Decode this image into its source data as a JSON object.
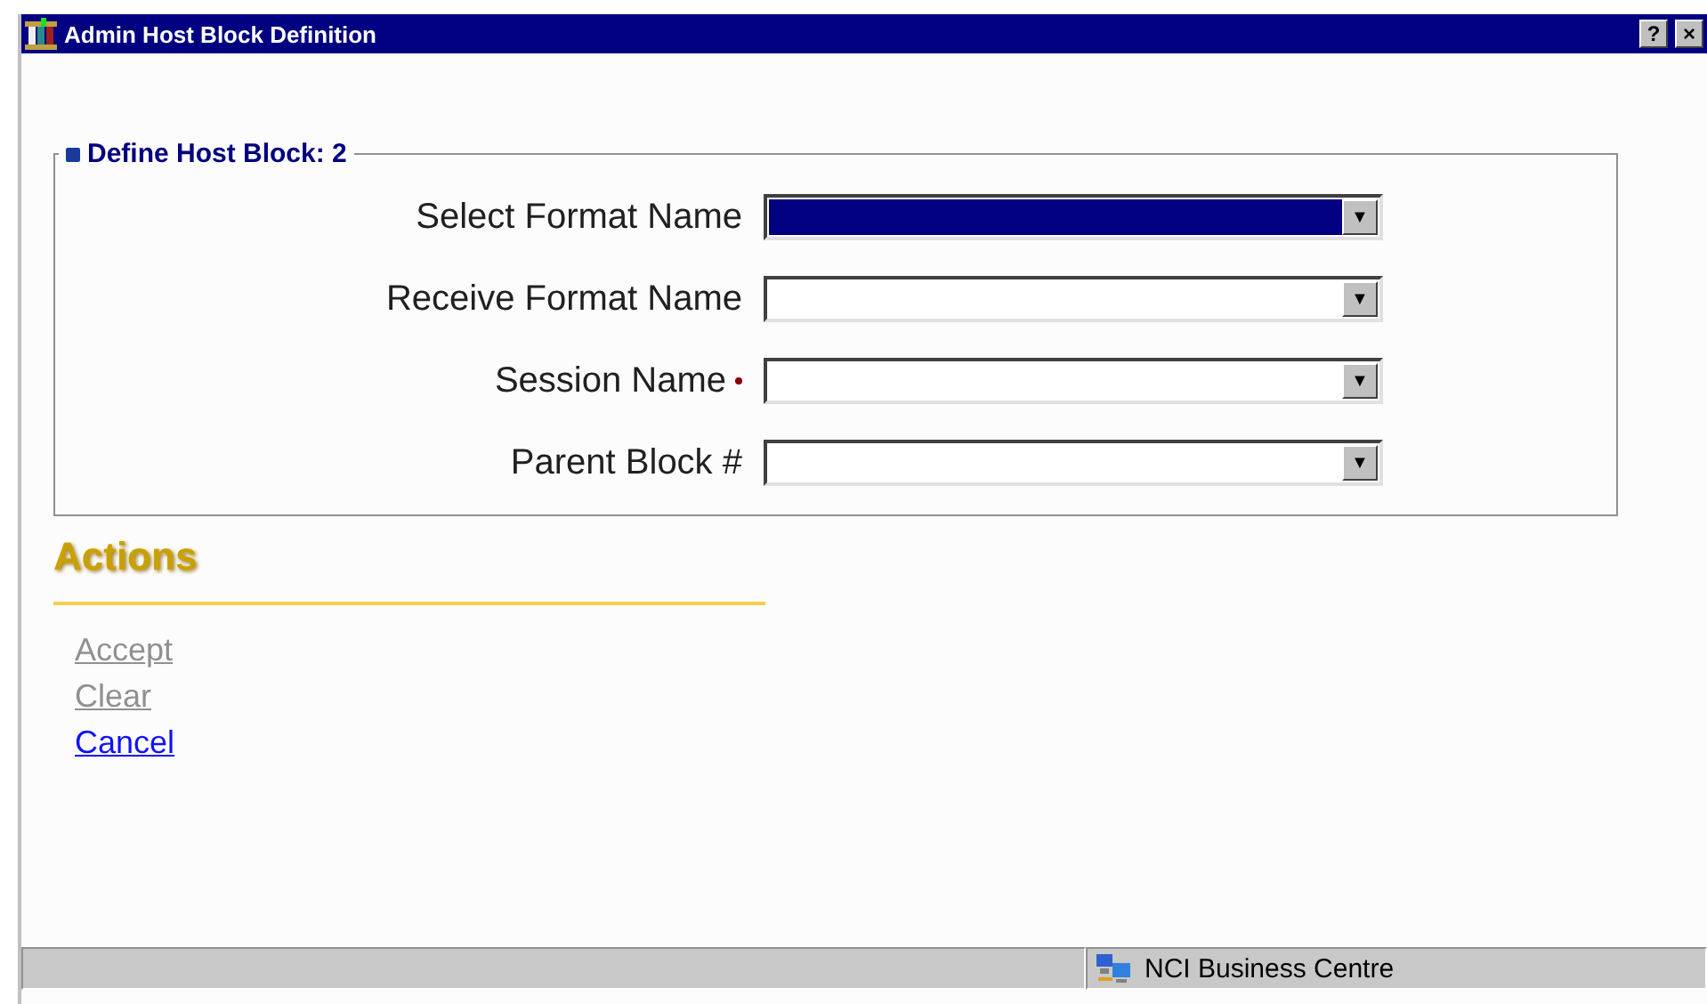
{
  "window": {
    "title": "Admin Host Block Definition",
    "buttons": [
      "?",
      "×"
    ]
  },
  "group": {
    "title": "Define Host Block: 2",
    "fields": [
      {
        "label": "Select Format Name",
        "required": false,
        "selected": true,
        "arrow": "▼"
      },
      {
        "label": "Receive Format Name",
        "required": false,
        "selected": false,
        "arrow": "▼"
      },
      {
        "label": "Session Name",
        "required": true,
        "selected": false,
        "arrow": "▼"
      },
      {
        "label": "Parent Block #",
        "required": false,
        "selected": false,
        "arrow": "▼"
      }
    ]
  },
  "actions": {
    "title": "Actions",
    "links": [
      {
        "label": "Accept",
        "disabled": true
      },
      {
        "label": "Clear",
        "disabled": true
      },
      {
        "label": "Cancel",
        "disabled": false
      }
    ]
  },
  "status_bar": {
    "text": "NCI Business Centre"
  }
}
